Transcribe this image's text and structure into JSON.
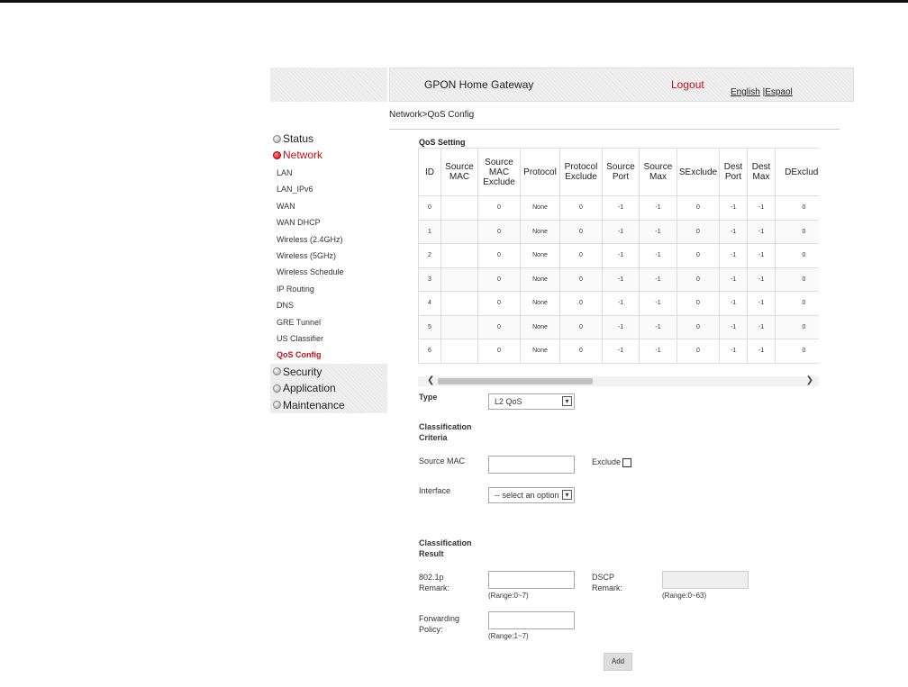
{
  "header": {
    "title": "GPON Home Gateway",
    "logout": "Logout",
    "lang_english": "English",
    "lang_sep": " |",
    "lang_espanol": "Espaol"
  },
  "breadcrumb": "Network>QoS Config",
  "nav": {
    "status": "Status",
    "network": "Network",
    "sub_items": [
      "LAN",
      "LAN_IPv6",
      "WAN",
      "WAN DHCP",
      "Wireless (2.4GHz)",
      "Wireless (5GHz)",
      "Wireless Schedule",
      "IP Routing",
      "DNS",
      "GRE Tunnel",
      "US Classifier",
      "QoS Config"
    ],
    "security": "Security",
    "application": "Application",
    "maintenance": "Maintenance"
  },
  "qos_setting": {
    "title": "QoS Setting",
    "headers": [
      "ID",
      "Source MAC",
      "Source MAC Exclude",
      "Protocol",
      "Protocol Exclude",
      "Source Port",
      "Source Max",
      "SExclude",
      "Dest Port",
      "Dest Max",
      "DExclude"
    ],
    "rows": [
      [
        "0",
        "",
        "0",
        "None",
        "0",
        "-1",
        "-1",
        "0",
        "-1",
        "-1",
        "0"
      ],
      [
        "1",
        "",
        "0",
        "None",
        "0",
        "-1",
        "-1",
        "0",
        "-1",
        "-1",
        "0"
      ],
      [
        "2",
        "",
        "0",
        "None",
        "0",
        "-1",
        "-1",
        "0",
        "-1",
        "-1",
        "0"
      ],
      [
        "3",
        "",
        "0",
        "None",
        "0",
        "-1",
        "-1",
        "0",
        "-1",
        "-1",
        "0"
      ],
      [
        "4",
        "",
        "0",
        "None",
        "0",
        "-1",
        "-1",
        "0",
        "-1",
        "-1",
        "0"
      ],
      [
        "5",
        "",
        "0",
        "None",
        "0",
        "-1",
        "-1",
        "0",
        "-1",
        "-1",
        "0"
      ],
      [
        "6",
        "",
        "0",
        "None",
        "0",
        "-1",
        "-1",
        "0",
        "-1",
        "-1",
        "0"
      ]
    ]
  },
  "form": {
    "type_label": "Type",
    "type_value": "L2 QoS",
    "criteria_heading_1": "Classification",
    "criteria_heading_2": "Criteria",
    "source_mac_label": "Source MAC",
    "exclude_label": "Exclude",
    "interface_label": "Interface",
    "interface_value": "-- select an option",
    "result_heading_1": "Classification",
    "result_heading_2": "Result",
    "remark8021p_label_1": "802.1p",
    "remark8021p_label_2": "Remark:",
    "remark8021p_range": "(Range:0~7)",
    "dscp_label_1": "DSCP",
    "dscp_label_2": "Remark:",
    "dscp_range": "(Range:0~63)",
    "forwarding_label_1": "Forwarding",
    "forwarding_label_2": "Policy:",
    "forwarding_range": "(Range:1~7)",
    "add_button": "Add"
  },
  "icons": {
    "select_arrow": "chevron-down-icon",
    "scroll_left": "chevron-left-icon",
    "scroll_right": "chevron-right-icon",
    "nav_bullet": "bullet-icon"
  },
  "colors": {
    "accent_red": "#c0111b"
  }
}
